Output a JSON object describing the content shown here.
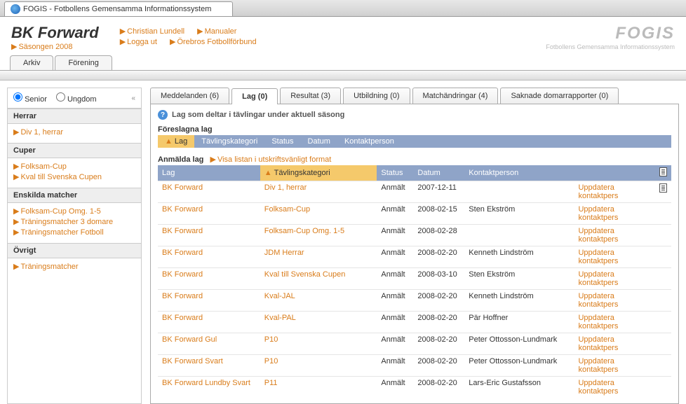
{
  "browser": {
    "tab_title": "FOGIS - Fotbollens Gemensamma Informationssystem"
  },
  "header": {
    "club": "BK Forward",
    "season": "Säsongen 2008",
    "user": "Christian Lundell",
    "manuals": "Manualer",
    "logout": "Logga ut",
    "federation": "Örebros Fotbollförbund",
    "logo_big": "FOGIS",
    "logo_small": "Fotbollens Gemensamma Informationssystem"
  },
  "top_tabs": {
    "arkiv": "Arkiv",
    "forening": "Förening"
  },
  "sidebar": {
    "radio_senior": "Senior",
    "radio_ungdom": "Ungdom",
    "herrar": {
      "title": "Herrar",
      "items": [
        "Div 1, herrar"
      ]
    },
    "cuper": {
      "title": "Cuper",
      "items": [
        "Folksam-Cup",
        "Kval till Svenska Cupen"
      ]
    },
    "enskilda": {
      "title": "Enskilda matcher",
      "items": [
        "Folksam-Cup Omg. 1-5",
        "Träningsmatcher 3 domare",
        "Träningsmatcher Fotboll"
      ]
    },
    "ovrigt": {
      "title": "Övrigt",
      "items": [
        "Träningsmatcher"
      ]
    }
  },
  "main_tabs": {
    "meddelanden": "Meddelanden (6)",
    "lag": "Lag (0)",
    "resultat": "Resultat (3)",
    "utbildning": "Utbildning (0)",
    "matchandringar": "Matchändringar (4)",
    "saknade": "Saknade domarrapporter (0)"
  },
  "panel": {
    "title": "Lag som deltar i tävlingar under aktuell säsong",
    "suggested_title": "Föreslagna lag",
    "suggest_cols": {
      "lag": "Lag",
      "tavling": "Tävlingskategori",
      "status": "Status",
      "datum": "Datum",
      "kontakt": "Kontaktperson"
    },
    "registered_title": "Anmälda lag",
    "print_link": "Visa listan i utskriftsvänligt format",
    "cols": {
      "lag": "Lag",
      "tavling": "Tävlingskategori",
      "status": "Status",
      "datum": "Datum",
      "kontakt": "Kontaktperson"
    },
    "update_label": "Uppdatera kontaktpers",
    "rows": [
      {
        "lag": "BK Forward",
        "tavling": "Div 1, herrar",
        "status": "Anmält",
        "datum": "2007-12-11",
        "kontakt": ""
      },
      {
        "lag": "BK Forward",
        "tavling": "Folksam-Cup",
        "status": "Anmält",
        "datum": "2008-02-15",
        "kontakt": "Sten Ekström"
      },
      {
        "lag": "BK Forward",
        "tavling": "Folksam-Cup Omg. 1-5",
        "status": "Anmält",
        "datum": "2008-02-28",
        "kontakt": ""
      },
      {
        "lag": "BK Forward",
        "tavling": "JDM Herrar",
        "status": "Anmält",
        "datum": "2008-02-20",
        "kontakt": "Kenneth Lindström"
      },
      {
        "lag": "BK Forward",
        "tavling": "Kval till Svenska Cupen",
        "status": "Anmält",
        "datum": "2008-03-10",
        "kontakt": "Sten Ekström"
      },
      {
        "lag": "BK Forward",
        "tavling": "Kval-JAL",
        "status": "Anmält",
        "datum": "2008-02-20",
        "kontakt": "Kenneth Lindström"
      },
      {
        "lag": "BK Forward",
        "tavling": "Kval-PAL",
        "status": "Anmält",
        "datum": "2008-02-20",
        "kontakt": "Pär Hoffner"
      },
      {
        "lag": "BK Forward Gul",
        "tavling": "P10",
        "status": "Anmält",
        "datum": "2008-02-20",
        "kontakt": "Peter Ottosson-Lundmark"
      },
      {
        "lag": "BK Forward Svart",
        "tavling": "P10",
        "status": "Anmält",
        "datum": "2008-02-20",
        "kontakt": "Peter Ottosson-Lundmark"
      },
      {
        "lag": "BK Forward Lundby Svart",
        "tavling": "P11",
        "status": "Anmält",
        "datum": "2008-02-20",
        "kontakt": "Lars-Eric Gustafsson"
      }
    ]
  }
}
